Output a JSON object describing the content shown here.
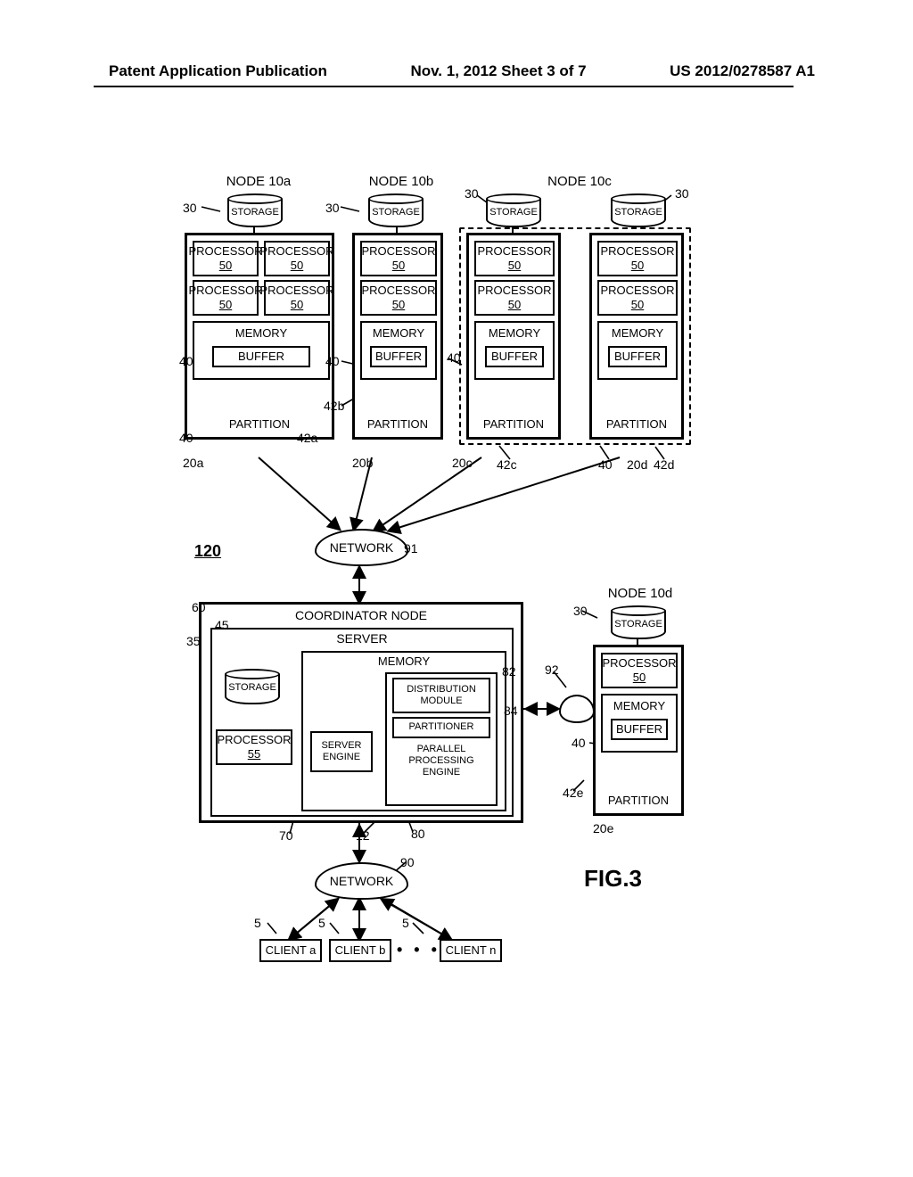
{
  "header": {
    "left": "Patent Application Publication",
    "center": "Nov. 1, 2012  Sheet 3 of 7",
    "right": "US 2012/0278587 A1"
  },
  "figure_label": "FIG.3",
  "system_ref": "120",
  "labels": {
    "node10a": "NODE 10a",
    "node10b": "NODE 10b",
    "node10c": "NODE 10c",
    "node10d": "NODE 10d",
    "coordinator": "COORDINATOR NODE",
    "server": "SERVER",
    "storage": "STORAGE",
    "processor": "PROCESSOR",
    "processor50": "50",
    "processor55": "55",
    "memory": "MEMORY",
    "buffer": "BUFFER",
    "partition": "PARTITION",
    "network": "NETWORK",
    "distribution_module": "DISTRIBUTION MODULE",
    "partitioner": "PARTITIONER",
    "parallel_engine": "PARALLEL PROCESSING ENGINE",
    "server_engine": "SERVER ENGINE",
    "client_a": "CLIENT a",
    "client_b": "CLIENT b",
    "client_n": "CLIENT n"
  },
  "refs": {
    "r30": "30",
    "r40": "40",
    "r42a": "42a",
    "r42b": "42b",
    "r42c": "42c",
    "r42d": "42d",
    "r42e": "42e",
    "r20a": "20a",
    "r20b": "20b",
    "r20c": "20c",
    "r20d": "20d",
    "r20e": "20e",
    "r60": "60",
    "r45": "45",
    "r35": "35",
    "r55": "55",
    "r70": "70",
    "r12": "12",
    "r80": "80",
    "r82": "82",
    "r84": "84",
    "r90": "90",
    "r91": "91",
    "r92": "92",
    "r5": "5"
  }
}
